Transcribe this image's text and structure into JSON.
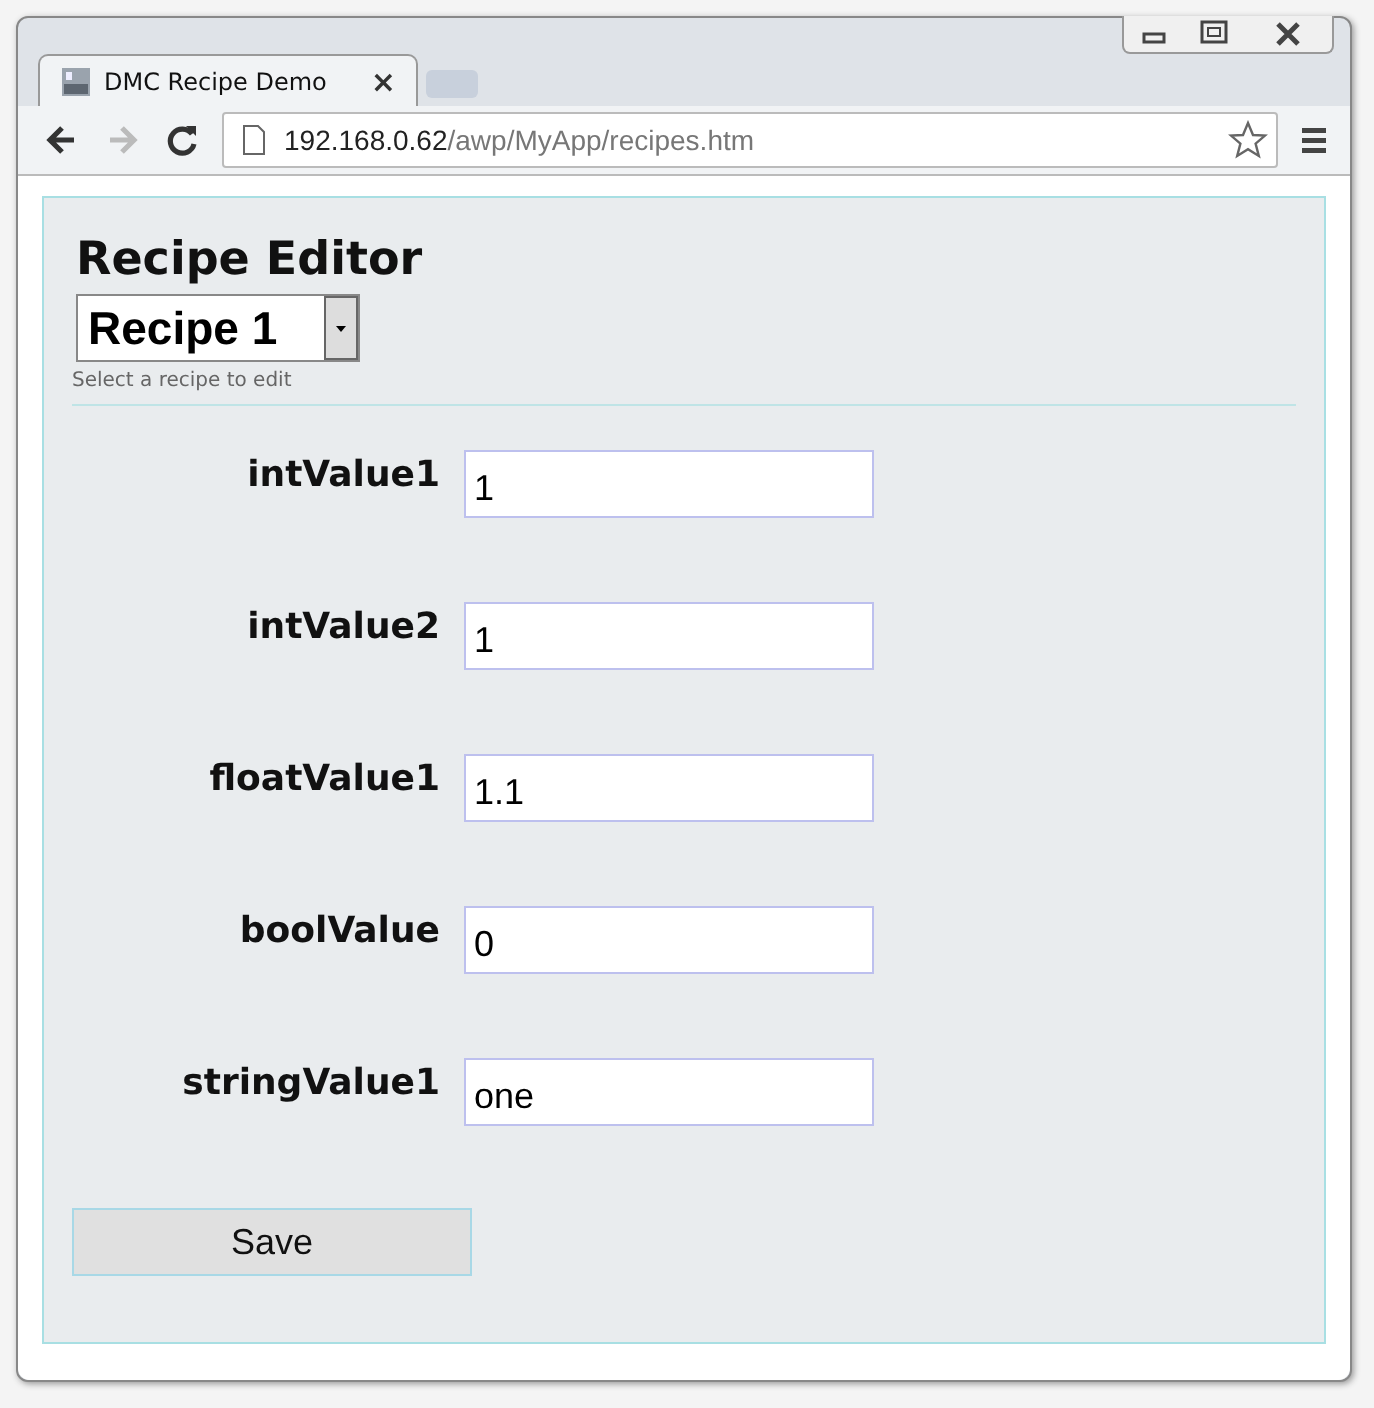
{
  "window": {
    "tab_title": "DMC Recipe Demo",
    "tab_close": "×"
  },
  "address_bar": {
    "host": "192.168.0.62",
    "path": "/awp/MyApp/recipes.htm"
  },
  "page": {
    "title": "Recipe Editor",
    "recipe_select": {
      "value": "Recipe 1"
    },
    "select_hint": "Select a recipe to edit",
    "fields": [
      {
        "label": "intValue1",
        "value": "1"
      },
      {
        "label": "intValue2",
        "value": "1"
      },
      {
        "label": "floatValue1",
        "value": "1.1"
      },
      {
        "label": "boolValue",
        "value": "0"
      },
      {
        "label": "stringValue1",
        "value": "one"
      }
    ],
    "save_button": "Save"
  }
}
